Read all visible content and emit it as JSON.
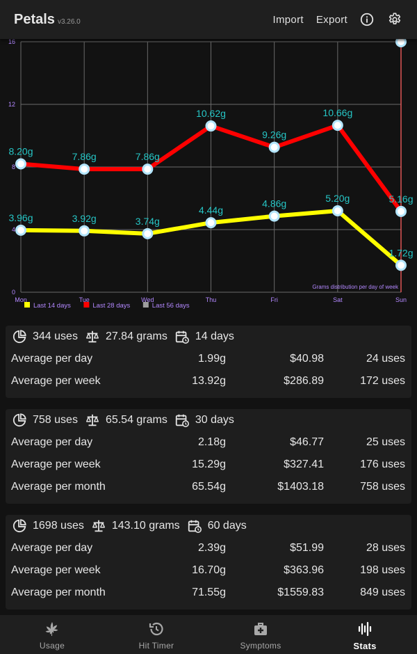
{
  "app": {
    "title": "Petals",
    "version": "v3.26.0"
  },
  "toolbar": {
    "import_label": "Import",
    "export_label": "Export"
  },
  "chart_data": {
    "type": "line",
    "categories": [
      "Mon",
      "Tue",
      "Wed",
      "Thu",
      "Fri",
      "Sat",
      "Sun"
    ],
    "ylim": [
      0,
      16
    ],
    "yticks": [
      0,
      4,
      8,
      12,
      16
    ],
    "annotation": "Grams distribution per day of week",
    "series": [
      {
        "name": "Last 14 days",
        "color": "#ffff00",
        "values": [
          3.96,
          3.92,
          3.74,
          4.44,
          4.86,
          5.2,
          1.72
        ],
        "labels": [
          "3.96g",
          "3.92g",
          "3.74g",
          "4.44g",
          "4.86g",
          "5.20g",
          "1.72g"
        ]
      },
      {
        "name": "Last 28 days",
        "color": "#ff0000",
        "values": [
          8.2,
          7.86,
          7.86,
          10.62,
          9.26,
          10.66,
          5.16
        ],
        "labels": [
          "8.20g",
          "7.86g",
          "7.86g",
          "10.62g",
          "9.26g",
          "10.66g",
          "5.16g"
        ]
      },
      {
        "name": "Last 56 days",
        "color": "#9e9e9e",
        "values": [],
        "labels": []
      }
    ],
    "highlight_category": "Sun",
    "point_color": "#b3e5fc",
    "label_color": "#26c6c6",
    "axis_label_color": "#b388ff"
  },
  "stats": [
    {
      "uses": "344 uses",
      "grams": "27.84 grams",
      "days": "14 days",
      "rows": [
        {
          "label": "Average per day",
          "grams": "1.99g",
          "dollars": "$40.98",
          "uses": "24 uses"
        },
        {
          "label": "Average per week",
          "grams": "13.92g",
          "dollars": "$286.89",
          "uses": "172 uses"
        }
      ]
    },
    {
      "uses": "758 uses",
      "grams": "65.54 grams",
      "days": "30 days",
      "rows": [
        {
          "label": "Average per day",
          "grams": "2.18g",
          "dollars": "$46.77",
          "uses": "25 uses"
        },
        {
          "label": "Average per week",
          "grams": "15.29g",
          "dollars": "$327.41",
          "uses": "176 uses"
        },
        {
          "label": "Average per month",
          "grams": "65.54g",
          "dollars": "$1403.18",
          "uses": "758 uses"
        }
      ]
    },
    {
      "uses": "1698 uses",
      "grams": "143.10 grams",
      "days": "60 days",
      "rows": [
        {
          "label": "Average per day",
          "grams": "2.39g",
          "dollars": "$51.99",
          "uses": "28 uses"
        },
        {
          "label": "Average per week",
          "grams": "16.70g",
          "dollars": "$363.96",
          "uses": "198 uses"
        },
        {
          "label": "Average per month",
          "grams": "71.55g",
          "dollars": "$1559.83",
          "uses": "849 uses"
        }
      ]
    }
  ],
  "nav": [
    {
      "label": "Usage",
      "icon": "cannabis-leaf-icon"
    },
    {
      "label": "Hit Timer",
      "icon": "timer-history-icon"
    },
    {
      "label": "Symptoms",
      "icon": "medical-bag-icon"
    },
    {
      "label": "Stats",
      "icon": "waveform-icon"
    }
  ]
}
